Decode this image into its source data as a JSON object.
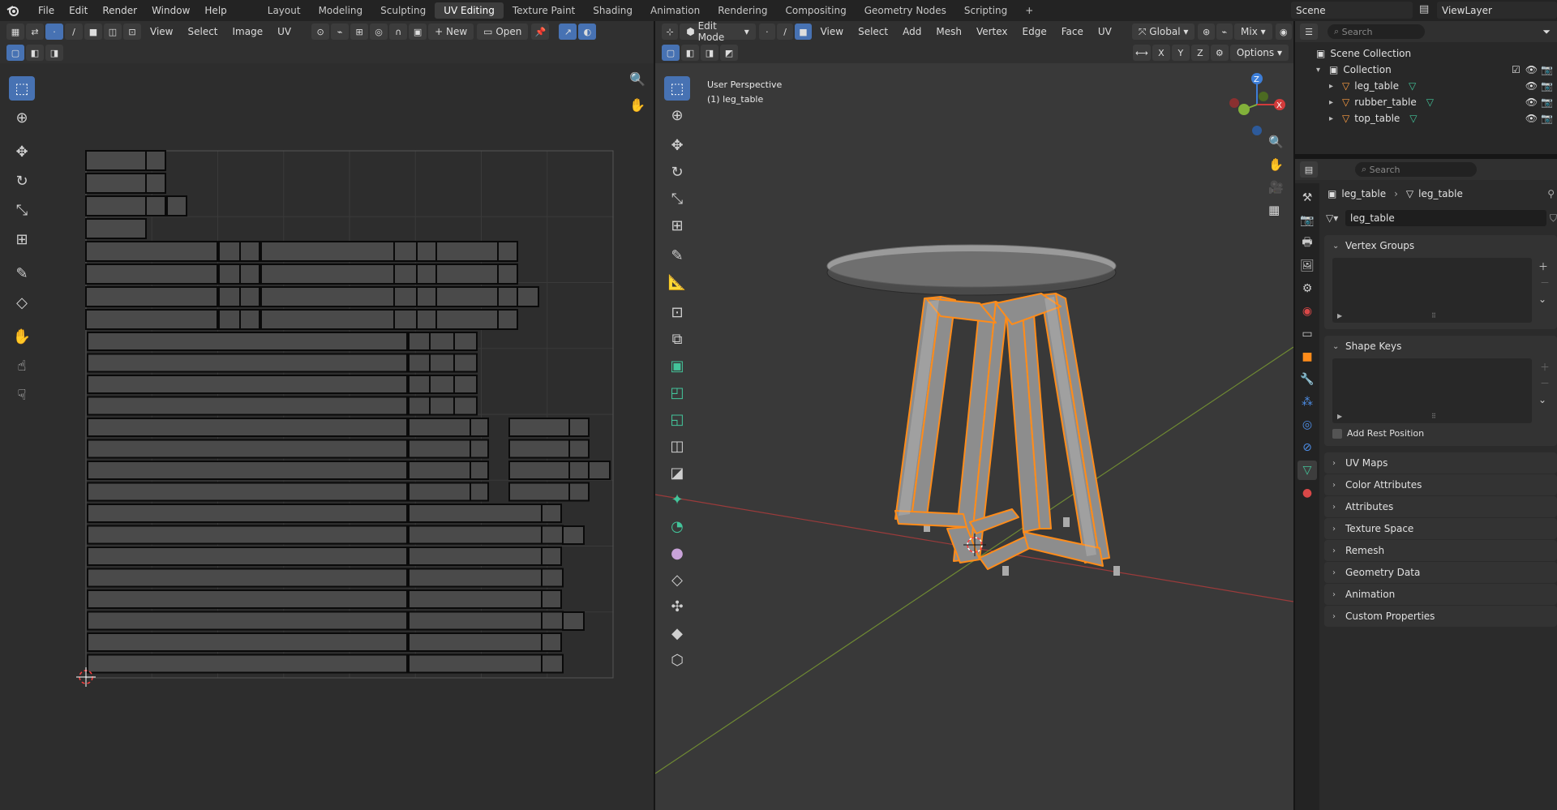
{
  "topbar": {
    "menus": [
      "File",
      "Edit",
      "Render",
      "Window",
      "Help"
    ],
    "workspaces": [
      "Layout",
      "Modeling",
      "Sculpting",
      "UV Editing",
      "Texture Paint",
      "Shading",
      "Animation",
      "Rendering",
      "Compositing",
      "Geometry Nodes",
      "Scripting"
    ],
    "active_workspace": "UV Editing",
    "scene": "Scene",
    "view_layer": "ViewLayer"
  },
  "uv_editor": {
    "menus": [
      "View",
      "Select",
      "Image",
      "UV"
    ],
    "new_label": "New",
    "open_label": "Open"
  },
  "viewport": {
    "mode": "Edit Mode",
    "menus": [
      "View",
      "Select",
      "Add",
      "Mesh",
      "Vertex",
      "Edge",
      "Face",
      "UV"
    ],
    "transform_orientation": "Global",
    "snap_mode": "Mix",
    "options_label": "Options",
    "overlay_line1": "User Perspective",
    "overlay_line2": "(1) leg_table",
    "axes": [
      "X",
      "Y",
      "Z"
    ]
  },
  "outliner": {
    "search_placeholder": "Search",
    "scene_collection": "Scene Collection",
    "collection": "Collection",
    "objects": [
      "leg_table",
      "rubber_table",
      "top_table"
    ]
  },
  "properties": {
    "search_placeholder": "Search",
    "breadcrumb_object": "leg_table",
    "breadcrumb_data": "leg_table",
    "data_name": "leg_table",
    "panels_open": [
      "Vertex Groups",
      "Shape Keys"
    ],
    "add_rest_position": "Add Rest Position",
    "panels_closed": [
      "UV Maps",
      "Color Attributes",
      "Attributes",
      "Texture Space",
      "Remesh",
      "Geometry Data",
      "Animation",
      "Custom Properties"
    ]
  },
  "colors": {
    "accent": "#4772b3",
    "selected_orange": "#ff8c1a",
    "mesh_green": "#43c49a",
    "axis_x": "#d33b3b",
    "axis_y": "#82b13a",
    "axis_z": "#3d7ed8"
  }
}
